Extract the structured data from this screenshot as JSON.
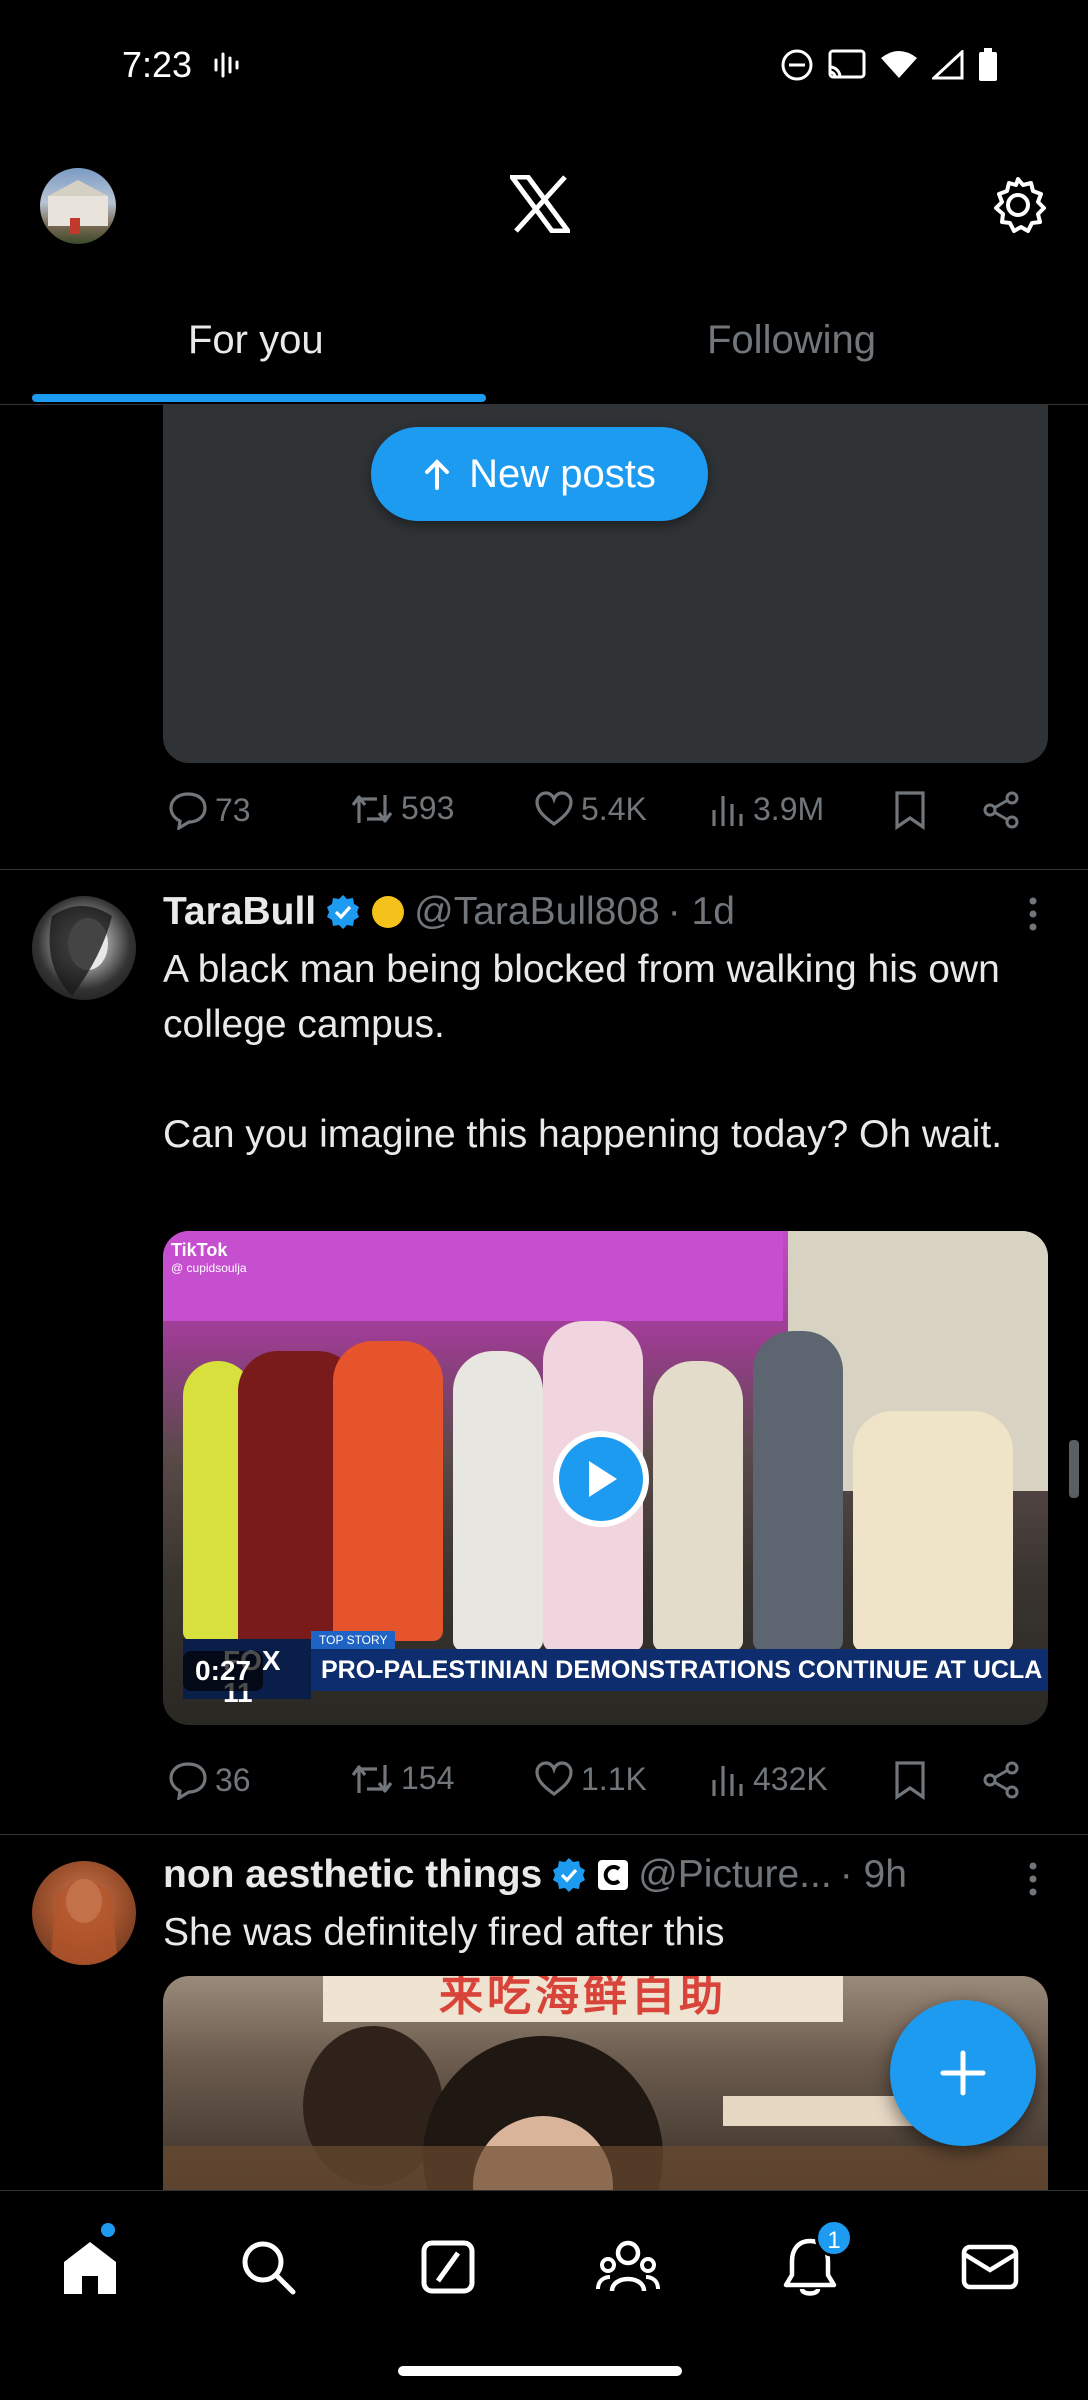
{
  "status": {
    "time": "7:23"
  },
  "header": {
    "logo": "X"
  },
  "tabs": [
    {
      "label": "For you",
      "active": true
    },
    {
      "label": "Following",
      "active": false
    }
  ],
  "new_posts": {
    "label": "New posts"
  },
  "post0": {
    "replies": "73",
    "reposts": "593",
    "likes": "5.4K",
    "views": "3.9M"
  },
  "post1": {
    "name": "TaraBull",
    "handle": "@TaraBull808",
    "time": "· 1d",
    "text1": "A black man being blocked from walking his own college campus.",
    "text2": "Can you imagine this happening today? Oh wait.",
    "video": {
      "duration": "0:27",
      "chyron_top": "TOP STORY",
      "chyron": "PRO-PALESTINIAN DEMONSTRATIONS CONTINUE AT UCLA",
      "network": "FOX 11",
      "watermark": "TikTok",
      "watermark_user": "@ cupidsoulja"
    },
    "replies": "36",
    "reposts": "154",
    "likes": "1.1K",
    "views": "432K"
  },
  "post2": {
    "name": "non aesthetic things",
    "handle": "@Picture...",
    "time": "· 9h",
    "text": "She was definitely fired after this",
    "image_banner": "来吃海鲜自助"
  },
  "nav": {
    "notifications_badge": "1"
  },
  "colors": {
    "accent": "#1d9bf0",
    "background": "#000000",
    "muted": "#71767b"
  }
}
